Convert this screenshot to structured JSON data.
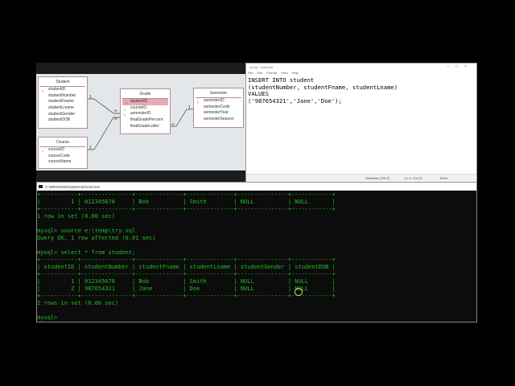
{
  "diagram": {
    "tables": [
      {
        "name": "Student",
        "fields": [
          {
            "n": "studentID",
            "key": true
          },
          {
            "n": "studentNumber"
          },
          {
            "n": "studentFname"
          },
          {
            "n": "studentLname"
          },
          {
            "n": "studentGender"
          },
          {
            "n": "studentDOB"
          }
        ]
      },
      {
        "name": "Course",
        "fields": [
          {
            "n": "courseID",
            "key": true
          },
          {
            "n": "courseCode"
          },
          {
            "n": "courseName"
          }
        ]
      },
      {
        "name": "Grade",
        "fields": [
          {
            "n": "studentID",
            "key": true,
            "selected": true
          },
          {
            "n": "courseID",
            "key": true
          },
          {
            "n": "semesterID",
            "key": true
          },
          {
            "n": "finalGradePercent"
          },
          {
            "n": "finalGradeLetter"
          }
        ]
      },
      {
        "name": "Semester",
        "fields": [
          {
            "n": "semesterID",
            "key": true
          },
          {
            "n": "semesterCode"
          },
          {
            "n": "semesterYear"
          },
          {
            "n": "semesterSeason"
          }
        ]
      }
    ],
    "one": "1",
    "many": "∞"
  },
  "notepad": {
    "title": "try.sql - Notepad",
    "menu": [
      "File",
      "Edit",
      "Format",
      "View",
      "Help"
    ],
    "text": "INSERT INTO student\n(studentNumber, studentFname, studentLname)\nVALUES\n('987654321','Jane','Doe');",
    "status": {
      "encoding": "Windows (CRLF)",
      "position": "Ln 4, Col 25",
      "zoom": "100%"
    }
  },
  "cmd": {
    "title": "C:\\WINDOWS\\System32\\cmd.exe",
    "lines": [
      "+-----------+---------------+--------------+--------------+---------------+------------+",
      "|         1 | 012345678     | Bob          | Smith        | NULL          | NULL       |",
      "+-----------+---------------+--------------+--------------+---------------+------------+",
      "1 row in set (0.00 sec)",
      "",
      "mysql> source e:\\temp\\try.sql",
      "Query OK, 1 row affected (0.01 sec)",
      "",
      "mysql> select * from student;",
      "+-----------+---------------+--------------+--------------+---------------+------------+",
      "| studentID | studentNumber | studentFname | studentLname | studentGender | studentDOB |",
      "+-----------+---------------+--------------+--------------+---------------+------------+",
      "|         1 | 012345678     | Bob          | Smith        | NULL          | NULL       |",
      "|         2 | 987654321     | Jane         | Doe          | NULL          | NULL       |",
      "+-----------+---------------+--------------+--------------+---------------+------------+",
      "2 rows in set (0.00 sec)",
      "",
      "mysql>"
    ]
  }
}
